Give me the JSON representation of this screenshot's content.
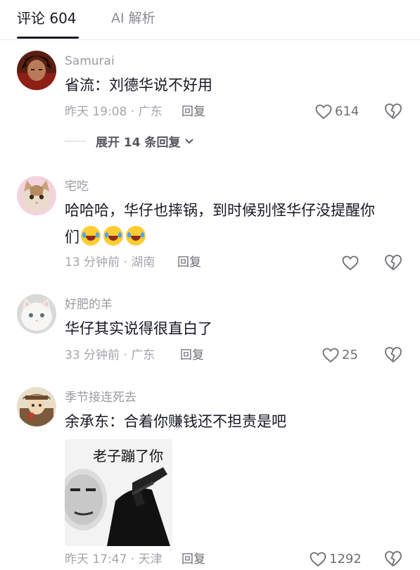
{
  "tabs": {
    "comments": "评论 604",
    "ai": "AI 解析"
  },
  "comments": [
    {
      "username": "Samurai",
      "text": "省流：刘德华说不好用",
      "meta": "昨天 19:08 · 广东",
      "reply": "回复",
      "likes": "614",
      "expand": "展开 14 条回复",
      "avatar": "avatar-samurai"
    },
    {
      "username": "宅吃",
      "text": "哈哈哈，华仔也摔锅，到时候别怪华仔没提醒你们",
      "text_line1": "哈哈哈，华仔也摔锅，到时候别怪华仔没提醒你",
      "text_line2": "们",
      "meta": "13 分钟前 · 湖南",
      "reply": "回复",
      "likes": "",
      "emoji": "laughing-crying-emoji",
      "avatar": "avatar-cat"
    },
    {
      "username": "好肥的羊",
      "text": "华仔其实说得很直白了",
      "meta": "33 分钟前 · 广东",
      "reply": "回复",
      "likes": "25",
      "avatar": "avatar-white-cat"
    },
    {
      "username": "季节接连死去",
      "text": "余承东：合着你赚钱还不担责是吧",
      "meta": "昨天 17:47 · 天津",
      "reply": "回复",
      "likes": "1292",
      "image_text": "老子蹦了你",
      "avatar": "avatar-cowboy"
    }
  ],
  "icons": {
    "like": "heart-outline-icon",
    "dislike": "broken-heart-icon",
    "expand": "chevron-down-icon"
  },
  "colors": {
    "text": "#161823",
    "secondary": "#9a9ba0",
    "divider": "#ececec"
  }
}
